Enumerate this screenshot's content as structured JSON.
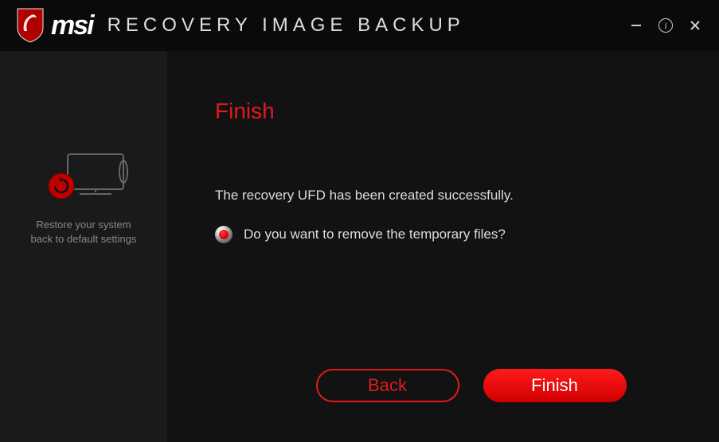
{
  "header": {
    "brand": "msi",
    "app_title": "RECOVERY IMAGE BACKUP"
  },
  "sidebar": {
    "caption_line1": "Restore your system",
    "caption_line2": "back to default settings"
  },
  "main": {
    "page_title": "Finish",
    "status_text": "The recovery UFD has been created successfully.",
    "radio_label": "Do you want to remove the temporary files?",
    "radio_selected": true,
    "buttons": {
      "back": "Back",
      "finish": "Finish"
    }
  }
}
